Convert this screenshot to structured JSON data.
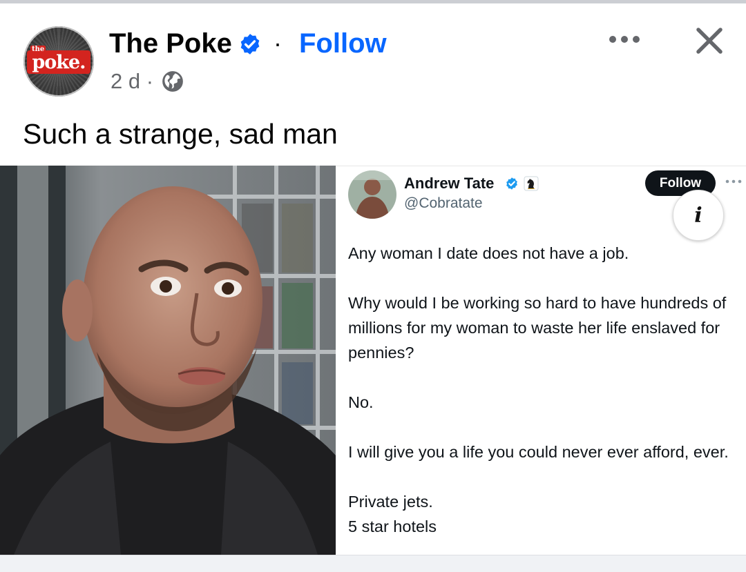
{
  "post": {
    "page_name": "The Poke",
    "follow_label": "Follow",
    "separator": "·",
    "time": "2 d ·",
    "caption": "Such a strange, sad man",
    "avatar_logo": "poke.",
    "avatar_small": "the"
  },
  "icons": {
    "verified": "verified-badge-icon",
    "globe": "globe-icon",
    "more": "more-options-icon",
    "close": "close-icon",
    "info": "info-icon"
  },
  "tweet": {
    "name": "Andrew Tate",
    "handle": "@Cobratate",
    "follow_label": "Follow",
    "info_glyph": "i",
    "paragraphs": [
      "Any woman I date does not have a job.",
      "Why would I be working so hard to have hundreds of millions for my woman to waste her life enslaved for pennies?",
      "No.",
      "I will give you a life you could never ever afford, ever.",
      "Private jets.",
      "5 star hotels"
    ]
  },
  "colors": {
    "brand_blue": "#0866ff",
    "text_primary": "#050505",
    "text_secondary": "#65676b",
    "poke_red": "#d3241f"
  }
}
